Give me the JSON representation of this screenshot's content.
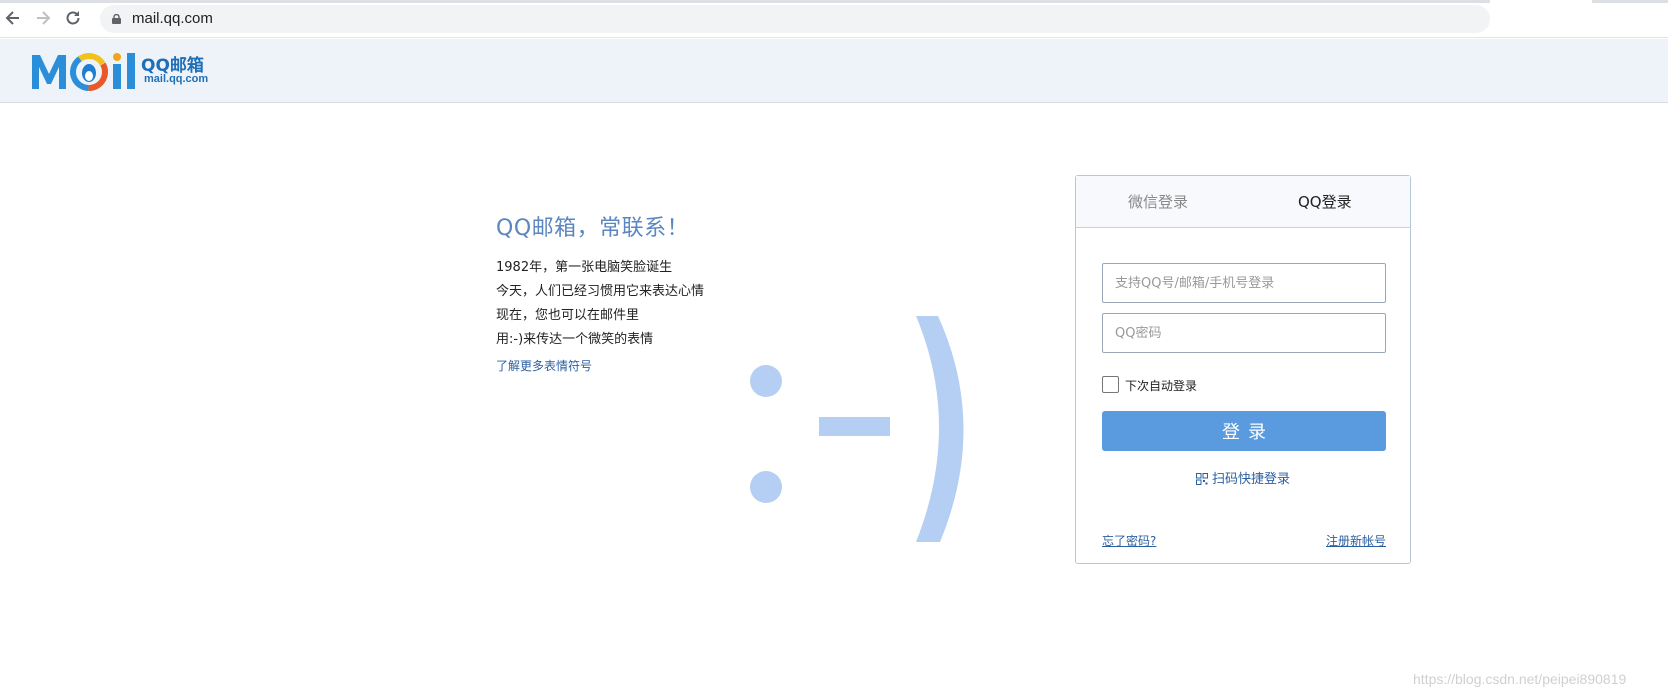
{
  "browser": {
    "url": "mail.qq.com",
    "back_icon": "arrow-left-icon",
    "forward_icon": "arrow-right-icon",
    "reload_icon": "reload-icon",
    "lock_icon": "lock-icon"
  },
  "header": {
    "logo_wordmark": "Mail",
    "logo_cn": "QQ邮箱",
    "logo_domain": "mail.qq.com"
  },
  "intro": {
    "title": "QQ邮箱，常联系！",
    "lines": [
      "1982年，第一张电脑笑脸诞生",
      "今天，人们已经习惯用它来表达心情",
      "现在，您也可以在邮件里",
      "用:-)来传达一个微笑的表情"
    ],
    "link": "了解更多表情符号"
  },
  "login": {
    "tab_wechat": "微信登录",
    "tab_qq": "QQ登录",
    "username_placeholder": "支持QQ号/邮箱/手机号登录",
    "password_placeholder": "QQ密码",
    "remember_label": "下次自动登录",
    "remember_checked": false,
    "submit_label": "登录",
    "qr_login": "扫码快捷登录",
    "forgot_password": "忘了密码?",
    "register": "注册新帐号"
  },
  "colors": {
    "header_bg": "#eef3fa",
    "accent": "#5a9ade",
    "smiley": "#b4cff3",
    "link": "#2a5fa2"
  },
  "watermark": "https://blog.csdn.net/peipei890819"
}
